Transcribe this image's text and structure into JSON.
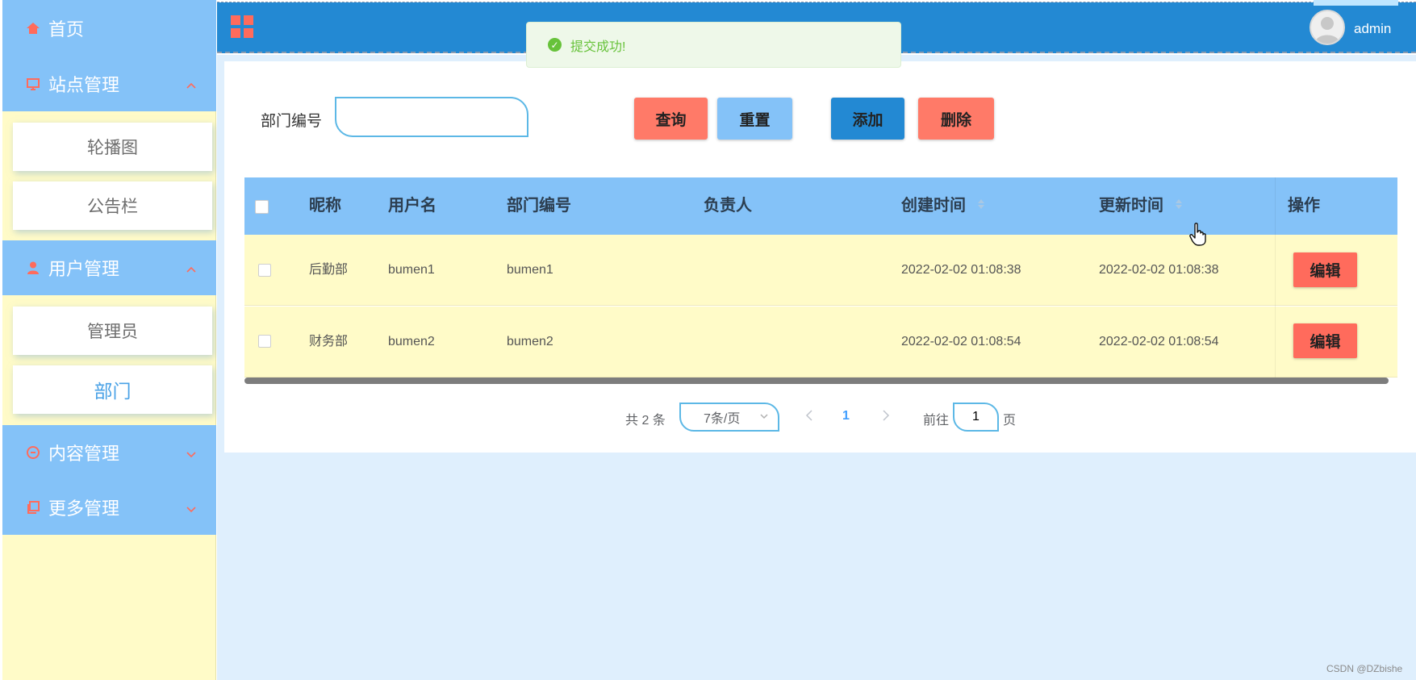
{
  "sidebar": {
    "home": "首页",
    "site_mgmt": "站点管理",
    "site_items": [
      "轮播图",
      "公告栏"
    ],
    "user_mgmt": "用户管理",
    "user_items": [
      "管理员",
      "部门"
    ],
    "content_mgmt": "内容管理",
    "more_mgmt": "更多管理"
  },
  "header": {
    "username": "admin"
  },
  "toast": {
    "message": "提交成功!"
  },
  "search": {
    "label": "部门编号",
    "value": "",
    "placeholder": ""
  },
  "buttons": {
    "query": "查询",
    "reset": "重置",
    "add": "添加",
    "delete": "删除"
  },
  "table": {
    "columns": [
      "昵称",
      "用户名",
      "部门编号",
      "负责人",
      "创建时间",
      "更新时间",
      "操作"
    ],
    "rows": [
      {
        "nickname": "后勤部",
        "username": "bumen1",
        "dept_no": "bumen1",
        "leader": "",
        "created": "2022-02-02 01:08:38",
        "updated": "2022-02-02 01:08:38",
        "action": "编辑"
      },
      {
        "nickname": "财务部",
        "username": "bumen2",
        "dept_no": "bumen2",
        "leader": "",
        "created": "2022-02-02 01:08:54",
        "updated": "2022-02-02 01:08:54",
        "action": "编辑"
      }
    ]
  },
  "pagination": {
    "total": "共 2 条",
    "page_size": "7条/页",
    "current": "1",
    "goto_label": "前往",
    "goto_value": "1",
    "page_unit": "页"
  },
  "watermark": "CSDN @DZbishe",
  "colors": {
    "sidebar_header": "#84c2f8",
    "sidebar_bg": "#fffbc8",
    "topbar": "#2389d3",
    "accent_red": "#ff7a68",
    "success": "#67c23a"
  }
}
